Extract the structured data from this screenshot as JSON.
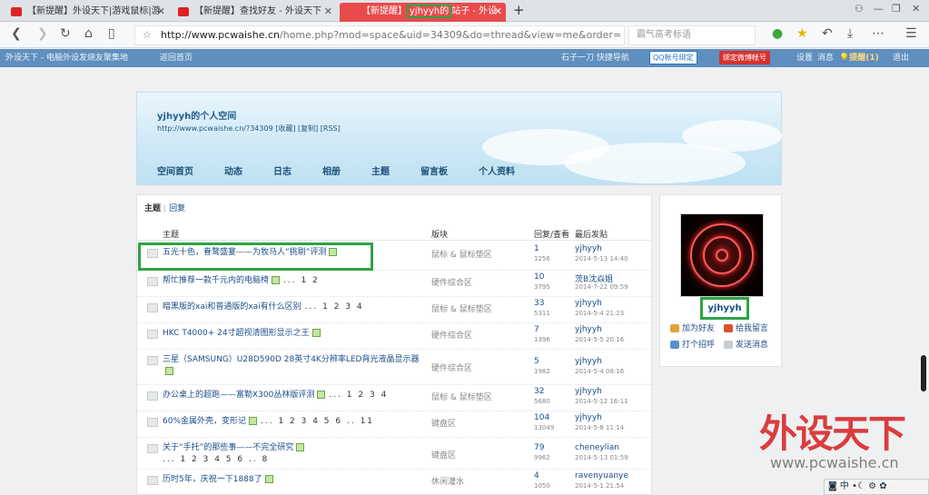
{
  "browser": {
    "tabs": [
      {
        "label": "【新提醒】外设天下|游戏鼠标|游"
      },
      {
        "label": "【新提醒】查找好友 - 外设天下"
      },
      {
        "label_prefix": "【新提醒】",
        "label_highlight": "yjhyyh的",
        "label_suffix": "站子 - 外设"
      }
    ],
    "url_base": "http://www.pcwaishe.cn",
    "url_rest": "/home.php?mod=space&uid=34309&do=thread&view=me&order=",
    "search_placeholder": "霸气高考标语"
  },
  "sitebar": {
    "left": "外设天下 - 电脑外设发烧友聚集地",
    "nav": "返回首页",
    "user": "石子一刀 快捷导航",
    "qq": "QQ帐号绑定",
    "weibo": "绑定微博帐号",
    "settings": "设置",
    "messages": "消息",
    "remind": "提醒(1)",
    "logout": "退出"
  },
  "space": {
    "title": "yjhyyh的个人空间",
    "url": "http://www.pcwaishe.cn/?34309 [收藏] [复制] [RSS]",
    "nav": [
      "空间首页",
      "动态",
      "日志",
      "相册",
      "主题",
      "留言板",
      "个人资料"
    ]
  },
  "tabs": {
    "active": "主题",
    "other": "回复"
  },
  "table": {
    "headers": {
      "title": "主题",
      "forum": "版块",
      "stats": "回复/查看",
      "last": "最后发贴"
    },
    "rows": [
      {
        "title": "五光十色，眷鹜盛宴——为牧马人“挑剔”评测",
        "pages": "",
        "forum": "鼠标 & 鼠标垫区",
        "replies": "1",
        "views": "1256",
        "author": "yjhyyh",
        "date": "2014-5-13 14:40"
      },
      {
        "title": "帮忙推荐一款千元内的电脑椅",
        "pages": "... 1 2",
        "forum": "硬件综合区",
        "replies": "10",
        "views": "3795",
        "author": "茨B沈焱姐",
        "date": "2014-7-22 09:59"
      },
      {
        "title": "暗黑版的xai和普通版的xai有什么区别",
        "pages": "... 1 2 3 4",
        "forum": "鼠标 & 鼠标垫区",
        "replies": "33",
        "views": "5311",
        "author": "yjhyyh",
        "date": "2014-5-4 21:23"
      },
      {
        "title": "HKC T4000+ 24寸超视清图形显示之王",
        "pages": "",
        "forum": "硬件综合区",
        "replies": "7",
        "views": "1396",
        "author": "yjhyyh",
        "date": "2014-5-5 20:16"
      },
      {
        "title": "三星（SAMSUNG）U28D590D 28英寸4K分辨率LED背光液晶显示器",
        "pages": "",
        "forum": "硬件综合区",
        "replies": "5",
        "views": "1982",
        "author": "yjhyyh",
        "date": "2014-5-4 08:16"
      },
      {
        "title": "办公桌上的超跑——富勒X300丛林版评测",
        "pages": "... 1 2 3 4",
        "forum": "鼠标 & 鼠标垫区",
        "replies": "32",
        "views": "5680",
        "author": "yjhyyh",
        "date": "2014-5-12 16:11"
      },
      {
        "title": "60%金属外壳，变形记",
        "pages": "... 1 2 3 4 5 6 .. 11",
        "forum": "键盘区",
        "replies": "104",
        "views": "13049",
        "author": "yjhyyh",
        "date": "2014-5-8 11:14"
      },
      {
        "title": "关于“手托”的那些事——不完全研究",
        "pages": "... 1 2 3 4 5 6 .. 8",
        "forum": "键盘区",
        "replies": "79",
        "views": "9962",
        "author": "cheneylian",
        "date": "2014-5-13 01:59"
      },
      {
        "title": "历时5年，庆祝一下1888了",
        "pages": "",
        "forum": "休闲灌水",
        "replies": "4",
        "views": "1050",
        "author": "ravenyuanye",
        "date": "2014-5-1 21:54"
      }
    ]
  },
  "profile": {
    "name": "yjhyyh",
    "add_friend": "加为好友",
    "leave_msg": "给我留言",
    "greet": "打个招呼",
    "send_msg": "发送消息"
  },
  "watermark": {
    "cn": "外设天下",
    "url": "www.pcwaishe.cn"
  },
  "tray": {
    "text": "中"
  },
  "colors": {
    "accent": "#e84b4b",
    "highlight": "#2ea343",
    "link": "#1a4e8a"
  }
}
